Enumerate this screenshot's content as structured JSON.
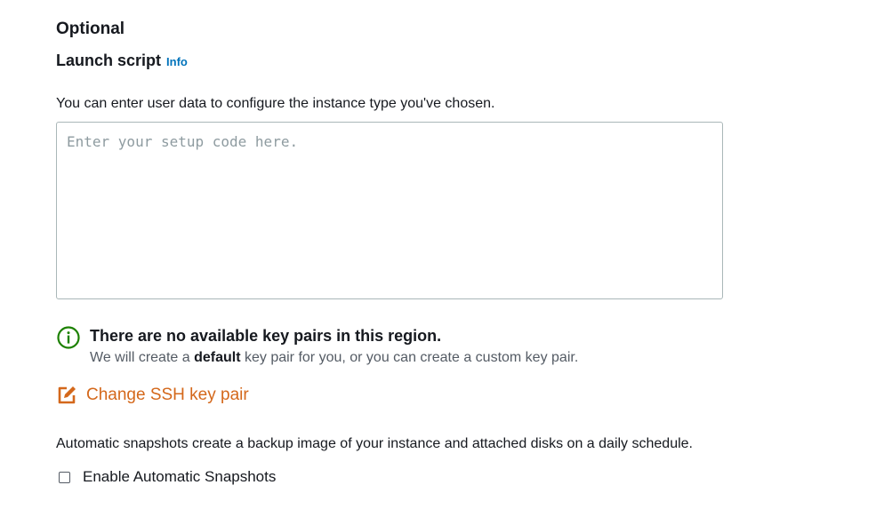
{
  "section": {
    "title": "Optional"
  },
  "launch_script": {
    "title": "Launch script",
    "info_label": "Info",
    "description": "You can enter user data to configure the instance type you've chosen.",
    "placeholder": "Enter your setup code here.",
    "value": ""
  },
  "key_pair_alert": {
    "icon": "info-circle-icon",
    "icon_color": "#1d8102",
    "title": "There are no available key pairs in this region.",
    "body_prefix": "We will create a ",
    "body_bold": "default",
    "body_suffix": " key pair for you, or you can create a custom key pair."
  },
  "change_ssh": {
    "icon": "edit-icon",
    "label": "Change SSH key pair",
    "color": "#d4681b"
  },
  "snapshots": {
    "description": "Automatic snapshots create a backup image of your instance and attached disks on a daily schedule.",
    "checkbox_label": "Enable Automatic Snapshots",
    "checked": false
  }
}
